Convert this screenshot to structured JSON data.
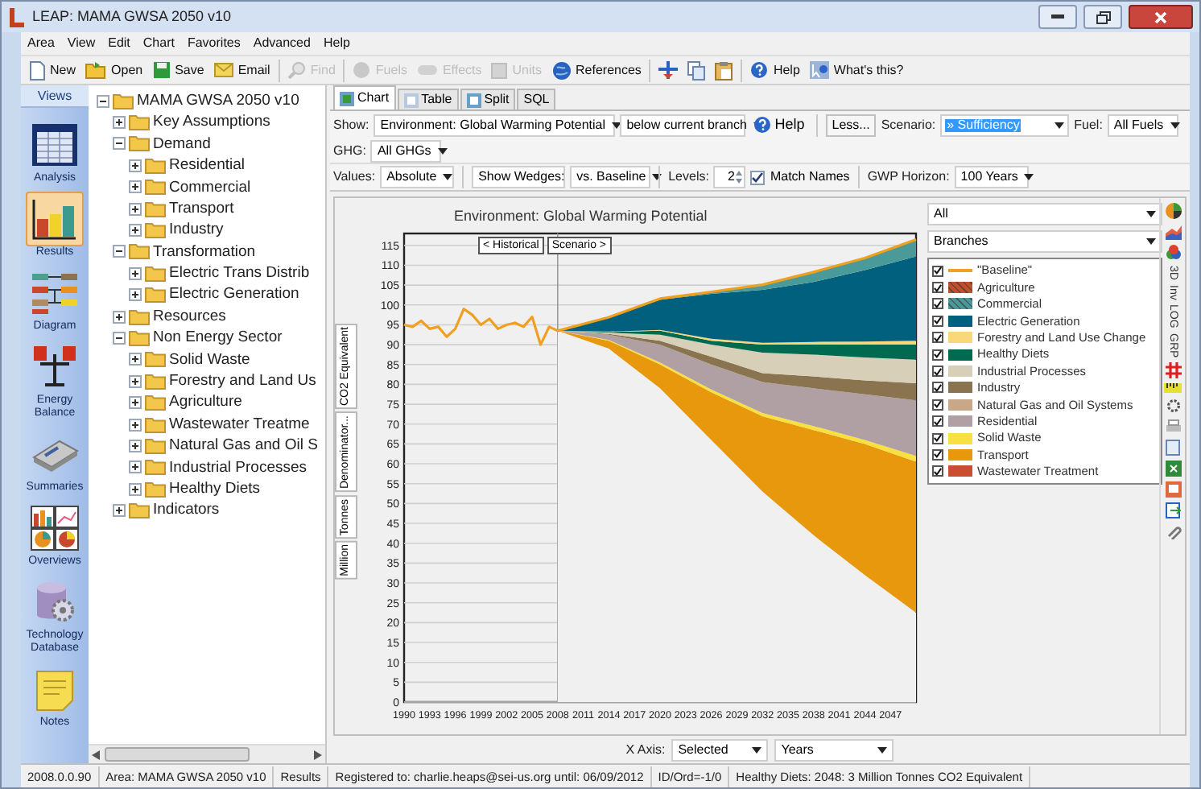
{
  "window": {
    "title": "LEAP: MAMA GWSA 2050 v10"
  },
  "menu": [
    "Area",
    "View",
    "Edit",
    "Chart",
    "Favorites",
    "Advanced",
    "Help"
  ],
  "toolbar_left": [
    {
      "label": "New",
      "disabled": false
    },
    {
      "label": "Open",
      "disabled": false
    },
    {
      "label": "Save",
      "disabled": false
    },
    {
      "label": "Email",
      "disabled": false
    },
    {
      "label": "Find",
      "disabled": true
    },
    {
      "label": "Fuels",
      "disabled": true
    },
    {
      "label": "Effects",
      "disabled": true
    },
    {
      "label": "Units",
      "disabled": true
    },
    {
      "label": "References",
      "disabled": false
    }
  ],
  "toolbar_right": [
    {
      "label": "Help",
      "disabled": false
    },
    {
      "label": "What's this?",
      "disabled": false
    }
  ],
  "views": {
    "title": "Views",
    "items": [
      {
        "label": "Analysis",
        "selected": false
      },
      {
        "label": "Results",
        "selected": true
      },
      {
        "label": "Diagram",
        "selected": false
      },
      {
        "label": "Energy Balance",
        "selected": false
      },
      {
        "label": "Summaries",
        "selected": false
      },
      {
        "label": "Overviews",
        "selected": false
      },
      {
        "label": "Technology Database",
        "selected": false
      },
      {
        "label": "Notes",
        "selected": false
      }
    ]
  },
  "tree": {
    "label": "MAMA GWSA 2050 v10",
    "expanded": true,
    "children": [
      {
        "label": "Key Assumptions",
        "expanded": false
      },
      {
        "label": "Demand",
        "expanded": true,
        "children": [
          {
            "label": "Residential",
            "expanded": false
          },
          {
            "label": "Commercial",
            "expanded": false
          },
          {
            "label": "Transport",
            "expanded": false
          },
          {
            "label": "Industry",
            "expanded": false
          }
        ]
      },
      {
        "label": "Transformation",
        "expanded": true,
        "children": [
          {
            "label": "Electric Trans Distrib",
            "expanded": false
          },
          {
            "label": "Electric Generation",
            "expanded": false
          }
        ]
      },
      {
        "label": "Resources",
        "expanded": false
      },
      {
        "label": "Non Energy Sector",
        "expanded": true,
        "children": [
          {
            "label": "Solid Waste",
            "expanded": false
          },
          {
            "label": "Forestry and Land Us",
            "expanded": false
          },
          {
            "label": "Agriculture",
            "expanded": false
          },
          {
            "label": "Wastewater Treatme",
            "expanded": false
          },
          {
            "label": "Natural Gas and Oil S",
            "expanded": false
          },
          {
            "label": "Industrial Processes",
            "expanded": false
          },
          {
            "label": "Healthy Diets",
            "expanded": false
          }
        ]
      },
      {
        "label": "Indicators",
        "expanded": false
      }
    ]
  },
  "tabs": [
    {
      "label": "Chart",
      "selected": true
    },
    {
      "label": "Table",
      "selected": false
    },
    {
      "label": "Split",
      "selected": false
    },
    {
      "label": "SQL",
      "selected": false
    }
  ],
  "show_row": {
    "show_label": "Show:",
    "show_value": "Environment: Global Warming Potential",
    "branch_value": "below current branch",
    "help": "Help",
    "less": "Less...",
    "scenario_label": "Scenario:",
    "scenario_text_selected": true,
    "fuel_label": "Fuel:",
    "fuel_value": "All Fuels"
  },
  "ghg_row": {
    "label": "GHG:",
    "value": "All GHGs"
  },
  "values_row": {
    "values_label": "Values:",
    "values_value": "Absolute",
    "wedges_value": "Show Wedges:",
    "vs_value": "vs. Baseline",
    "levels_label": "Levels:",
    "levels_value": "2",
    "match_names": {
      "label": "Match Names",
      "checked": true
    },
    "gwp_label": "GWP Horizon:",
    "gwp_value": "100 Years"
  },
  "chart": {
    "historical_button": "< Historical",
    "scenario_button": "Scenario >",
    "unit_tabs": [
      "CO2 Equivalent",
      "Denominator...",
      "Tonnes",
      "Million"
    ],
    "filter_value": "All",
    "group_value": "Branches",
    "legend": [
      {
        "checked": true,
        "kind": "line"
      },
      {
        "checked": true,
        "kind": "hatched"
      },
      {
        "checked": true,
        "kind": "hatched"
      },
      {
        "checked": true,
        "kind": "swatch"
      },
      {
        "checked": true,
        "kind": "swatch"
      },
      {
        "checked": true,
        "kind": "swatch"
      },
      {
        "checked": true,
        "kind": "swatch"
      },
      {
        "checked": true,
        "kind": "swatch"
      },
      {
        "checked": true,
        "kind": "swatch"
      },
      {
        "checked": true,
        "kind": "swatch"
      },
      {
        "checked": true,
        "kind": "swatch"
      },
      {
        "checked": true,
        "kind": "swatch"
      },
      {
        "checked": true,
        "kind": "swatch"
      }
    ],
    "tool_labels": [
      "3D",
      "Inv",
      "LOG",
      "GRP"
    ],
    "chart_data": {
      "type": "area",
      "title": "Environment: Global Warming Potential",
      "stacked": true,
      "grid": true,
      "xlim": [
        1990,
        2050
      ],
      "ylim": [
        0,
        118
      ],
      "x": [
        1990,
        1991,
        1992,
        1993,
        1994,
        1995,
        1996,
        1997,
        1998,
        1999,
        2000,
        2001,
        2002,
        2003,
        2004,
        2005,
        2006,
        2007,
        2008,
        2014,
        2020,
        2026,
        2032,
        2038,
        2044,
        2050
      ],
      "xticks": [
        1990,
        1993,
        1996,
        1999,
        2002,
        2005,
        2008,
        2011,
        2014,
        2017,
        2020,
        2023,
        2026,
        2029,
        2032,
        2035,
        2038,
        2041,
        2044,
        2047
      ],
      "yticks": [
        0,
        5,
        10,
        15,
        20,
        25,
        30,
        35,
        40,
        45,
        50,
        55,
        60,
        65,
        70,
        75,
        80,
        85,
        90,
        95,
        100,
        105,
        110,
        115
      ],
      "ref_lines": [
        {
          "axis": "x",
          "value": 2008
        }
      ],
      "series": [
        {
          "name": "\"Baseline\"",
          "type": "line",
          "color": "#f0a020",
          "values": [
            95,
            94.5,
            96,
            94,
            94.5,
            92,
            94,
            99,
            97.5,
            95,
            96.5,
            94,
            95,
            95.5,
            94.5,
            97,
            90,
            94.5,
            93.5,
            96.9,
            101.6,
            103.3,
            105.1,
            108.3,
            111.8,
            116.5
          ]
        },
        {
          "name": "» Sufficiency",
          "type": "area",
          "color": "#f0f0f0",
          "values": [
            null,
            null,
            null,
            null,
            null,
            null,
            null,
            null,
            null,
            null,
            null,
            null,
            null,
            null,
            null,
            null,
            null,
            null,
            93.5,
            89,
            79,
            66,
            53,
            42,
            32,
            22.5
          ]
        },
        {
          "name": "Transport",
          "type": "area",
          "color": "#e8980c",
          "values": [
            null,
            null,
            null,
            null,
            null,
            null,
            null,
            null,
            null,
            null,
            null,
            null,
            null,
            null,
            null,
            null,
            null,
            null,
            0,
            2,
            6,
            12,
            19,
            26.5,
            33,
            38
          ]
        },
        {
          "name": "Solid Waste",
          "type": "area",
          "color": "#f8e040",
          "values": [
            null,
            null,
            null,
            null,
            null,
            null,
            null,
            null,
            null,
            null,
            null,
            null,
            null,
            null,
            null,
            null,
            null,
            null,
            0,
            0.2,
            0.5,
            0.7,
            0.8,
            1,
            1,
            1.5
          ]
        },
        {
          "name": "Residential",
          "type": "area",
          "color": "#b0a0a4",
          "values": [
            null,
            null,
            null,
            null,
            null,
            null,
            null,
            null,
            null,
            null,
            null,
            null,
            null,
            null,
            null,
            null,
            null,
            null,
            0,
            1.3,
            4.5,
            6.3,
            7.8,
            9.5,
            11.5,
            14
          ]
        },
        {
          "name": "Industry",
          "type": "area",
          "color": "#8a7450",
          "values": [
            null,
            null,
            null,
            null,
            null,
            null,
            null,
            null,
            null,
            null,
            null,
            null,
            null,
            null,
            null,
            null,
            null,
            null,
            0,
            0.2,
            1,
            2,
            2.2,
            3,
            3.5,
            4.3
          ]
        },
        {
          "name": "Industrial Processes",
          "type": "area",
          "color": "#d8cfb8",
          "values": [
            null,
            null,
            null,
            null,
            null,
            null,
            null,
            null,
            null,
            null,
            null,
            null,
            null,
            null,
            null,
            null,
            null,
            null,
            0,
            0.3,
            1.5,
            3,
            5.2,
            5.5,
            5.8,
            5.9
          ]
        },
        {
          "name": "Healthy Diets",
          "type": "area",
          "color": "#006a50",
          "values": [
            null,
            null,
            null,
            null,
            null,
            null,
            null,
            null,
            null,
            null,
            null,
            null,
            null,
            null,
            null,
            null,
            null,
            null,
            0,
            0.2,
            1,
            1,
            2,
            2.5,
            3.2,
            3.8
          ]
        },
        {
          "name": "Forestry and Land Use Change",
          "type": "area",
          "color": "#f8d878",
          "values": [
            null,
            null,
            null,
            null,
            null,
            null,
            null,
            null,
            null,
            null,
            null,
            null,
            null,
            null,
            null,
            null,
            null,
            null,
            0,
            0.1,
            0.2,
            0.5,
            0.5,
            0.7,
            0.8,
            1
          ]
        },
        {
          "name": "Natural Gas and Oil Systems",
          "type": "area",
          "color": "#c8a888",
          "values": [
            null,
            null,
            null,
            null,
            null,
            null,
            null,
            null,
            null,
            null,
            null,
            null,
            null,
            null,
            null,
            null,
            null,
            null,
            null,
            null,
            null,
            null,
            null,
            null,
            null,
            null
          ]
        },
        {
          "name": "Wastewater Treatment",
          "type": "area",
          "color": "#c85030",
          "values": [
            null,
            null,
            null,
            null,
            null,
            null,
            null,
            null,
            null,
            null,
            null,
            null,
            null,
            null,
            null,
            null,
            null,
            null,
            null,
            null,
            null,
            null,
            null,
            null,
            null,
            null
          ]
        },
        {
          "name": "Agriculture",
          "type": "area",
          "color": "#c0502a",
          "values": [
            null,
            null,
            null,
            null,
            null,
            null,
            null,
            null,
            null,
            null,
            null,
            null,
            null,
            null,
            null,
            null,
            null,
            null,
            null,
            null,
            null,
            null,
            null,
            null,
            null,
            null
          ]
        },
        {
          "name": "Electric Generation",
          "type": "area",
          "color": "#00607e",
          "values": [
            null,
            null,
            null,
            null,
            null,
            null,
            null,
            null,
            null,
            null,
            null,
            null,
            null,
            null,
            null,
            null,
            null,
            null,
            0,
            3.5,
            7.6,
            11.3,
            13.3,
            15.1,
            18,
            21.2
          ]
        },
        {
          "name": "Commercial",
          "type": "area",
          "color": "#4a9a9a",
          "values": [
            null,
            null,
            null,
            null,
            null,
            null,
            null,
            null,
            null,
            null,
            null,
            null,
            null,
            null,
            null,
            null,
            null,
            null,
            0,
            0.1,
            0.3,
            0.5,
            1.3,
            2.5,
            3,
            4.3
          ]
        }
      ]
    }
  },
  "x_axis": {
    "label": "X Axis:",
    "value": "Selected",
    "unit_value": "Years"
  },
  "status_bar": [
    "2008.0.0.90",
    "Area: MAMA GWSA 2050 v10",
    "Results",
    "Registered to: charlie.heaps@sei-us.org until: 06/09/2012",
    "ID/Ord=-1/0",
    "Healthy Diets: 2048: 3 Million Tonnes CO2 Equivalent"
  ]
}
